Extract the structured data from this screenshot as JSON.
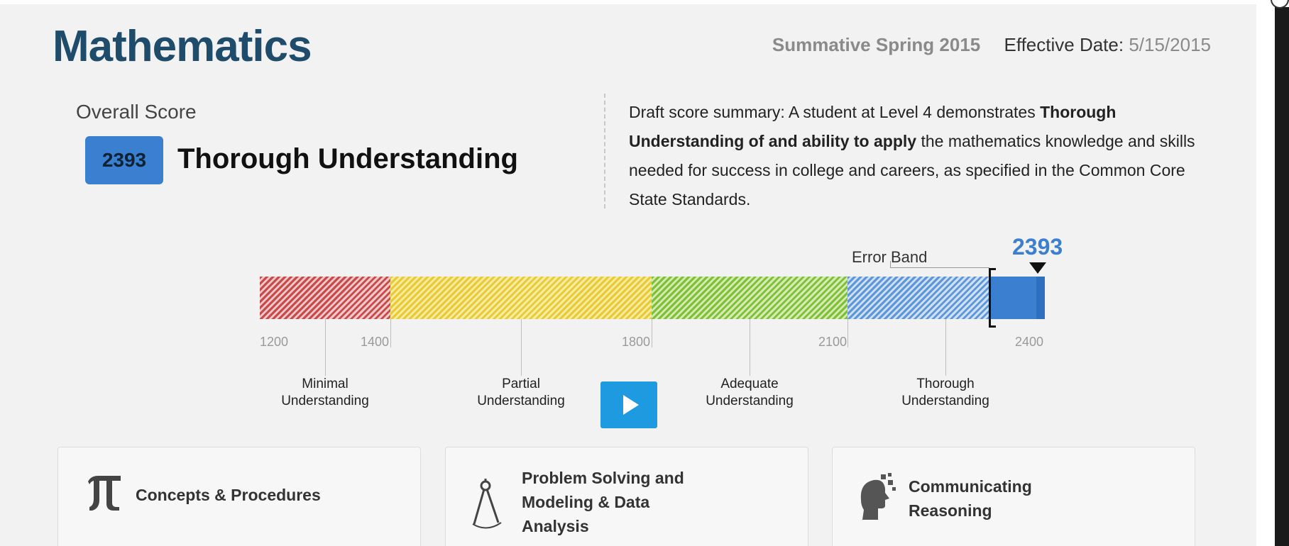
{
  "header": {
    "title": "Mathematics",
    "assessment": "Summative Spring 2015",
    "effective_label": "Effective Date:",
    "effective_date": "5/15/2015"
  },
  "overall": {
    "label": "Overall Score",
    "score": "2393",
    "level": "Thorough Understanding"
  },
  "summary": {
    "prefix": "Draft score summary: A student at Level 4 demonstrates ",
    "bold": "Thorough Understanding of and ability to apply",
    "suffix": " the mathematics knowledge and skills needed for success in college and careers, as specified in the Common Core State Standards."
  },
  "scale": {
    "error_band_label": "Error Band",
    "marker_value": "2393",
    "ticks": [
      "1200",
      "1400",
      "1800",
      "2100",
      "2400"
    ],
    "levels": [
      {
        "line1": "Minimal",
        "line2": "Understanding"
      },
      {
        "line1": "Partial",
        "line2": "Understanding"
      },
      {
        "line1": "Adequate",
        "line2": "Understanding"
      },
      {
        "line1": "Thorough",
        "line2": "Understanding"
      }
    ],
    "colors": {
      "minimal": "#c94a4a",
      "partial": "#e8c93a",
      "adequate": "#7fbf3a",
      "thorough": "#5d96d9",
      "score": "#3a7fd0"
    }
  },
  "cards": [
    {
      "title": "Concepts & Procedures",
      "icon": "pi-icon"
    },
    {
      "title_lines": [
        "Problem Solving and",
        "Modeling & Data",
        "Analysis"
      ],
      "icon": "compass-icon"
    },
    {
      "title_lines": [
        "Communicating",
        "Reasoning"
      ],
      "icon": "speaking-head-icon"
    }
  ],
  "controls": {
    "play_icon": "play-icon"
  }
}
